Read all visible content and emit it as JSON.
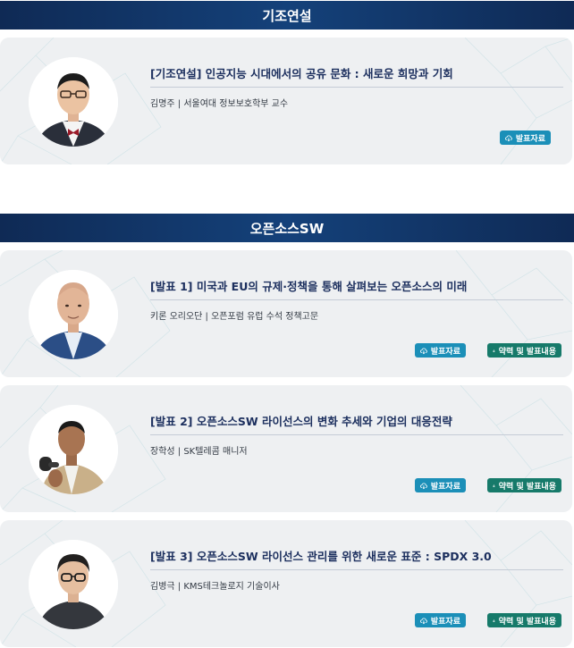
{
  "sections": [
    {
      "title": "기조연설"
    },
    {
      "title": "오픈소스SW"
    }
  ],
  "talks": [
    {
      "title": "[기조연설] 인공지능 시대에서의 공유 문화 : 새로운 희망과 기회",
      "speaker": "김명주 | 서울여대 정보보호학부 교수",
      "slides_label": "발표자료",
      "photo": "speaker-portrait-glasses-bowtie"
    },
    {
      "title": "[발표 1] 미국과 EU의 규제·정책을 통해 살펴보는 오픈소스의 미래",
      "speaker": "키론 오리오단 | 오픈포럼 유럽 수석 정책고문",
      "slides_label": "발표자료",
      "profile_label": "약력 및 발표내용",
      "photo": "speaker-portrait-bald-suit"
    },
    {
      "title": "[발표 2] 오픈소스SW 라이선스의 변화 추세와 기업의 대응전략",
      "speaker": "장학성 | SK텔레콤 매니저",
      "slides_label": "발표자료",
      "profile_label": "약력 및 발표내용",
      "photo": "speaker-portrait-microphone"
    },
    {
      "title": "[발표 3] 오픈소스SW 라이선스 관리를 위한 새로운 표준 : SPDX 3.0",
      "speaker": "김병극 | KMS테크놀로지 기술이사",
      "slides_label": "발표자료",
      "profile_label": "약력 및 발표내용",
      "photo": "speaker-portrait-glasses-dark"
    }
  ],
  "colors": {
    "header_bg": "#14417a",
    "title_text": "#1c2f5e",
    "slides_button": "#1b8fb8",
    "profile_button": "#167a6a",
    "card_bg": "#eef0f2"
  },
  "icons": {
    "slides": "cloud-download-icon",
    "profile": "podium-icon"
  }
}
